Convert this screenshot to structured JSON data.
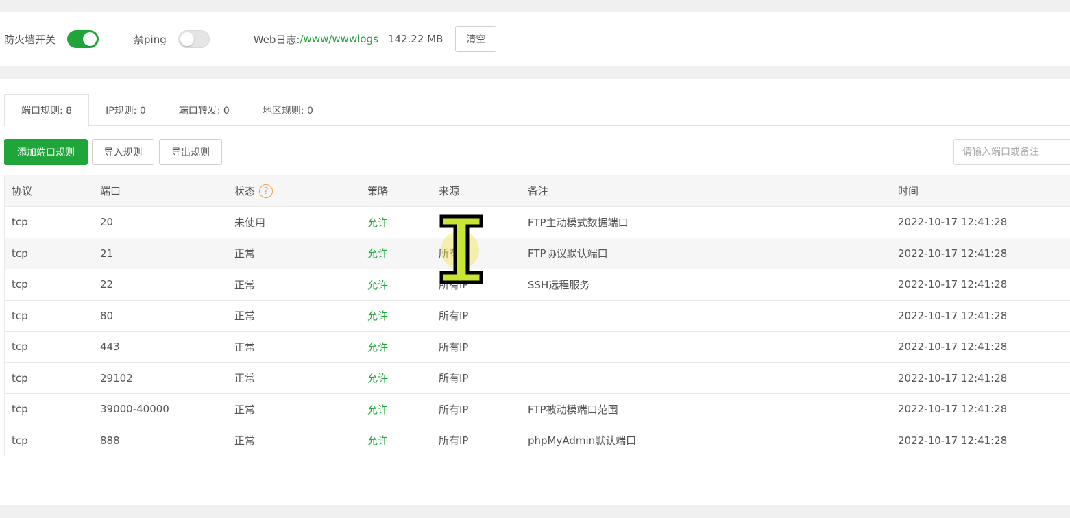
{
  "topbar": {
    "firewall_label": "防火墙开关",
    "firewall_on": true,
    "noping_label": "禁ping",
    "noping_on": false,
    "weblog_label": "Web日志:",
    "weblog_path": "/www/wwwlogs",
    "weblog_size": "142.22 MB",
    "clear_label": "清空"
  },
  "tabs": [
    {
      "label": "端口规则:  8",
      "active": true
    },
    {
      "label": "IP规则:  0",
      "active": false
    },
    {
      "label": "端口转发:  0",
      "active": false
    },
    {
      "label": "地区规则:  0",
      "active": false
    }
  ],
  "toolbar": {
    "add_label": "添加端口规则",
    "import_label": "导入规则",
    "export_label": "导出规则",
    "search_placeholder": "请输入端口或备注"
  },
  "table": {
    "headers": {
      "protocol": "协议",
      "port": "端口",
      "status": "状态",
      "policy": "策略",
      "source": "来源",
      "remark": "备注",
      "time": "时间"
    },
    "help_icon": "?",
    "rows": [
      {
        "protocol": "tcp",
        "port": "20",
        "status": "未使用",
        "policy": "允许",
        "source": "",
        "remark": "FTP主动模式数据端口",
        "time": "2022-10-17 12:41:28"
      },
      {
        "protocol": "tcp",
        "port": "21",
        "status": "正常",
        "policy": "允许",
        "source": "所有IP",
        "remark": "FTP协议默认端口",
        "time": "2022-10-17 12:41:28"
      },
      {
        "protocol": "tcp",
        "port": "22",
        "status": "正常",
        "policy": "允许",
        "source": "所有IP",
        "remark": "SSH远程服务",
        "time": "2022-10-17 12:41:28"
      },
      {
        "protocol": "tcp",
        "port": "80",
        "status": "正常",
        "policy": "允许",
        "source": "所有IP",
        "remark": "",
        "time": "2022-10-17 12:41:28"
      },
      {
        "protocol": "tcp",
        "port": "443",
        "status": "正常",
        "policy": "允许",
        "source": "所有IP",
        "remark": "",
        "time": "2022-10-17 12:41:28"
      },
      {
        "protocol": "tcp",
        "port": "29102",
        "status": "正常",
        "policy": "允许",
        "source": "所有IP",
        "remark": "",
        "time": "2022-10-17 12:41:28"
      },
      {
        "protocol": "tcp",
        "port": "39000-40000",
        "status": "正常",
        "policy": "允许",
        "source": "所有IP",
        "remark": "FTP被动模端口范围",
        "time": "2022-10-17 12:41:28"
      },
      {
        "protocol": "tcp",
        "port": "888",
        "status": "正常",
        "policy": "允许",
        "source": "所有IP",
        "remark": "phpMyAdmin默认端口",
        "time": "2022-10-17 12:41:28"
      }
    ]
  },
  "colors": {
    "accent": "#20a53a",
    "help": "#f0a040"
  }
}
